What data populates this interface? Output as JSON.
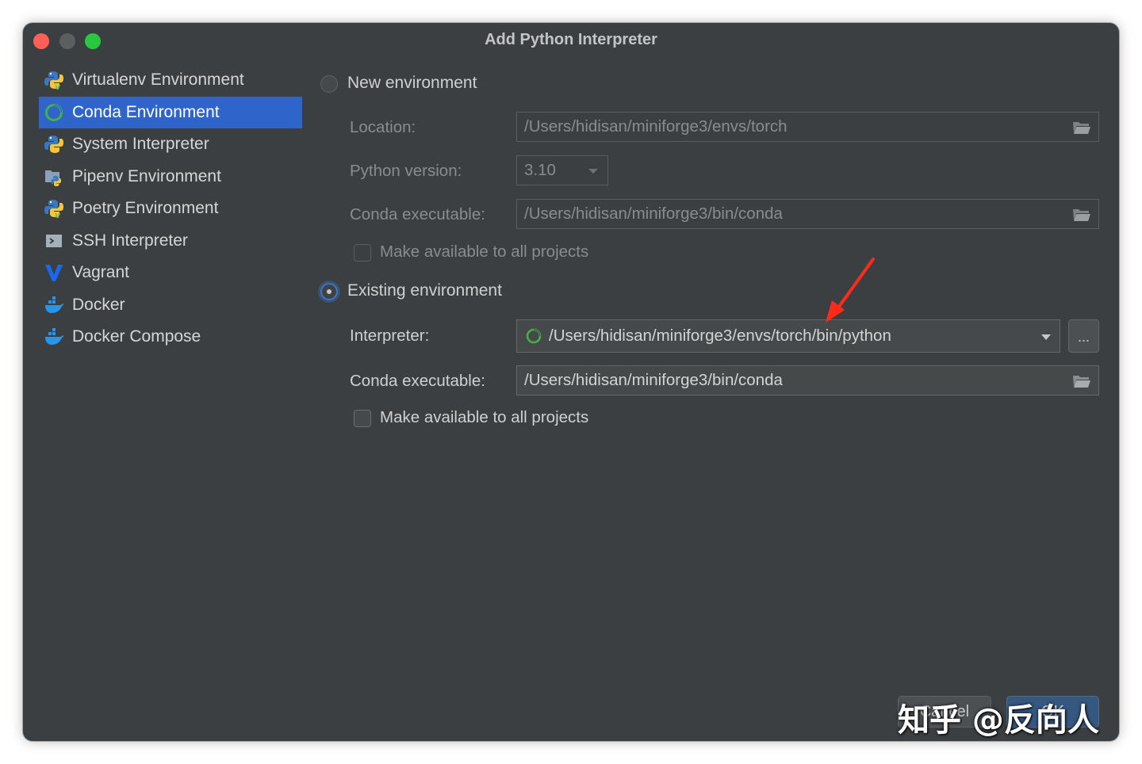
{
  "window": {
    "title": "Add Python Interpreter"
  },
  "sidebar": {
    "items": [
      {
        "label": "Virtualenv Environment",
        "icon": "python-virtualenv-icon",
        "selected": false
      },
      {
        "label": "Conda Environment",
        "icon": "conda-icon",
        "selected": true
      },
      {
        "label": "System Interpreter",
        "icon": "python-icon",
        "selected": false
      },
      {
        "label": "Pipenv Environment",
        "icon": "pipenv-icon",
        "selected": false
      },
      {
        "label": "Poetry Environment",
        "icon": "poetry-icon",
        "selected": false
      },
      {
        "label": "SSH Interpreter",
        "icon": "ssh-terminal-icon",
        "selected": false
      },
      {
        "label": "Vagrant",
        "icon": "vagrant-icon",
        "selected": false
      },
      {
        "label": "Docker",
        "icon": "docker-icon",
        "selected": false
      },
      {
        "label": "Docker Compose",
        "icon": "docker-compose-icon",
        "selected": false
      }
    ]
  },
  "new_env": {
    "radio_label": "New environment",
    "selected": false,
    "location_label": "Location:",
    "location_value": "/Users/hidisan/miniforge3/envs/torch",
    "python_version_label": "Python version:",
    "python_version_value": "3.10",
    "conda_exe_label": "Conda executable:",
    "conda_exe_value": "/Users/hidisan/miniforge3/bin/conda",
    "make_available_label": "Make available to all projects"
  },
  "existing_env": {
    "radio_label": "Existing environment",
    "selected": true,
    "interpreter_label": "Interpreter:",
    "interpreter_value": "/Users/hidisan/miniforge3/envs/torch/bin/python",
    "browse_label": "...",
    "conda_exe_label": "Conda executable:",
    "conda_exe_value": "/Users/hidisan/miniforge3/bin/conda",
    "make_available_label": "Make available to all projects"
  },
  "buttons": {
    "cancel_label": "Cancel",
    "ok_label": "OK"
  },
  "watermark": "知乎 @反向人",
  "colors": {
    "selection": "#2f65ca",
    "annotation_arrow": "#ff2a1a",
    "background": "#3c3f41"
  }
}
